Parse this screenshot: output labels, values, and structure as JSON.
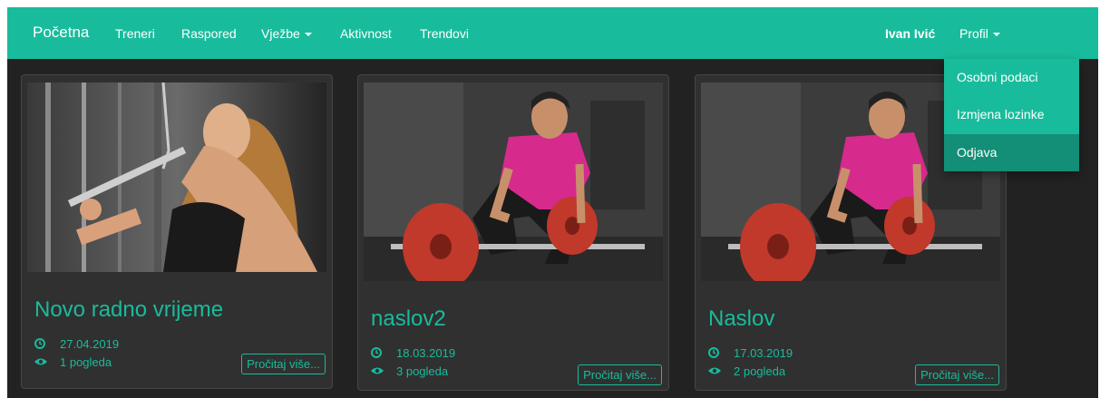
{
  "navbar": {
    "brand": "Početna",
    "items": [
      "Treneri",
      "Raspored",
      "Vježbe",
      "Aktivnost",
      "Trendovi"
    ],
    "user": "Ivan Ivić",
    "profile": "Profil"
  },
  "profile_menu": {
    "items": [
      "Osobni podaci",
      "Izmjena lozinke",
      "Odjava"
    ],
    "active": "Odjava"
  },
  "cards": [
    {
      "title": "Novo radno vrijeme",
      "date": "27.04.2019",
      "views": "1 pogleda",
      "button": "Pročitaj više...",
      "image": "woman doing lat pulldown"
    },
    {
      "title": "naslov2",
      "date": "18.03.2019",
      "views": "3 pogleda",
      "button": "Pročitaj više...",
      "image": "man deadlifting barbell"
    },
    {
      "title": "Naslov",
      "date": "17.03.2019",
      "views": "2 pogleda",
      "button": "Pročitaj više...",
      "image": "man deadlifting barbell"
    }
  ],
  "colors": {
    "accent": "#18bc9c",
    "background": "#222222",
    "card": "#303030",
    "dropdown_active": "#128f76"
  }
}
